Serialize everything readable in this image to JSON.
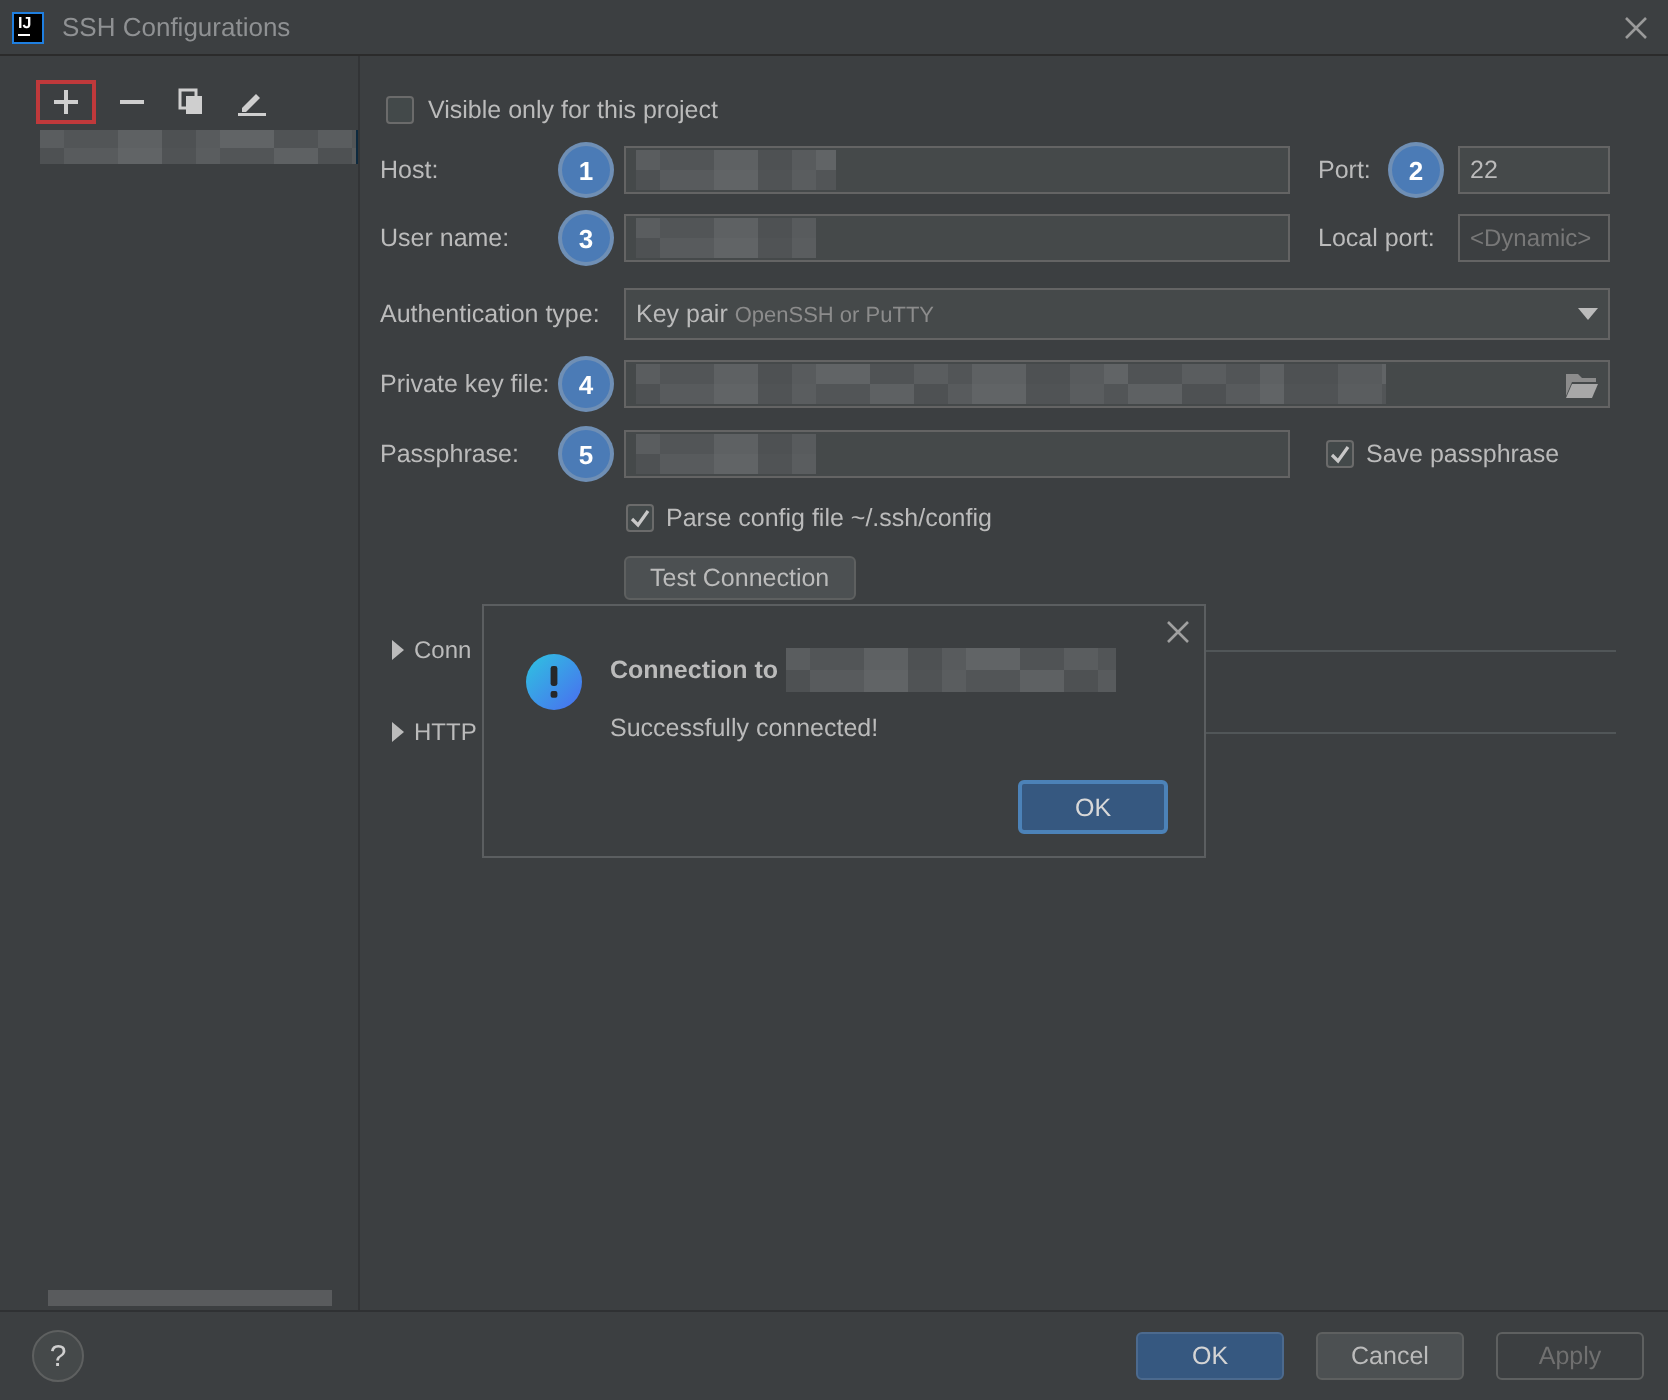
{
  "window": {
    "logo": "IJ",
    "title": "SSH Configurations"
  },
  "toolbar": [
    {
      "kind": "add",
      "highlighted": true
    },
    {
      "kind": "remove",
      "highlighted": false
    },
    {
      "kind": "copy",
      "highlighted": false
    },
    {
      "kind": "edit",
      "highlighted": false
    }
  ],
  "sidebar": {
    "items": [
      {
        "redacted": true,
        "selected": true
      }
    ]
  },
  "form": {
    "visible_only_for_project": {
      "label": "Visible only for this project",
      "checked": false
    },
    "host": {
      "label": "Host:",
      "marker": "1",
      "redacted": true
    },
    "port": {
      "label": "Port:",
      "marker": "2",
      "value": "22"
    },
    "user_name": {
      "label": "User name:",
      "marker": "3",
      "redacted": true
    },
    "local_port": {
      "label": "Local port:",
      "placeholder": "<Dynamic>",
      "disabled": true
    },
    "authentication_type": {
      "label": "Authentication type:",
      "value": "Key pair",
      "hint": "OpenSSH or PuTTY"
    },
    "private_key_file": {
      "label": "Private key file:",
      "marker": "4",
      "redacted": true
    },
    "passphrase": {
      "label": "Passphrase:",
      "marker": "5",
      "redacted": true
    },
    "save_passphrase": {
      "label": "Save passphrase",
      "checked": true
    },
    "parse_config": {
      "label": "Parse config file ~/.ssh/config",
      "checked": true
    },
    "test_button": "Test Connection"
  },
  "sections": [
    {
      "label": "Conn",
      "expanded": false
    },
    {
      "label": "HTTP",
      "expanded": false
    }
  ],
  "dialog": {
    "title": "Connection to",
    "title_redacted": true,
    "message": "Successfully connected!",
    "button": "OK"
  },
  "help_button": "?",
  "buttons": [
    {
      "label": "OK",
      "kind": "primary",
      "disabled": false
    },
    {
      "label": "Cancel",
      "kind": "normal",
      "disabled": false
    },
    {
      "label": "Apply",
      "kind": "normal",
      "disabled": true
    }
  ]
}
